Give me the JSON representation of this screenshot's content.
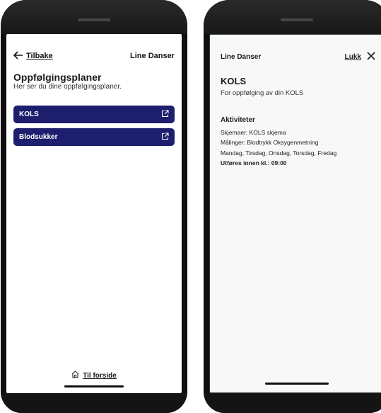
{
  "left_screen": {
    "back_label": "Tilbake",
    "user_name": "Line Danser",
    "heading": "Oppfølgingsplaner",
    "subheading": "Her ser du dine oppfølgingsplaner.",
    "plans": [
      {
        "label": "KOLS",
        "icon": "external-link-icon"
      },
      {
        "label": "Blodsukker",
        "icon": "external-link-icon"
      }
    ],
    "footer_label": "Til forside",
    "footer_icon": "home-icon"
  },
  "right_screen": {
    "user_name": "Line Danser",
    "close_label": "Lukk",
    "close_icon": "close-icon",
    "title": "KOLS",
    "subtitle": "For oppfølging av din KOLS",
    "activities_heading": "Aktiviteter",
    "schemas": "Skjemaer: KOLS skjema",
    "measurements": "Målinger: Blodtrykk Oksygenmetning",
    "days": "Mandag, Tirsdag, Onsdag, Torsdag, Fredag",
    "deadline": "Utføres innen kl.: 09:00"
  },
  "colors": {
    "plan_button": "#1d1f6e",
    "phone_frame": "#0f0f0f"
  }
}
